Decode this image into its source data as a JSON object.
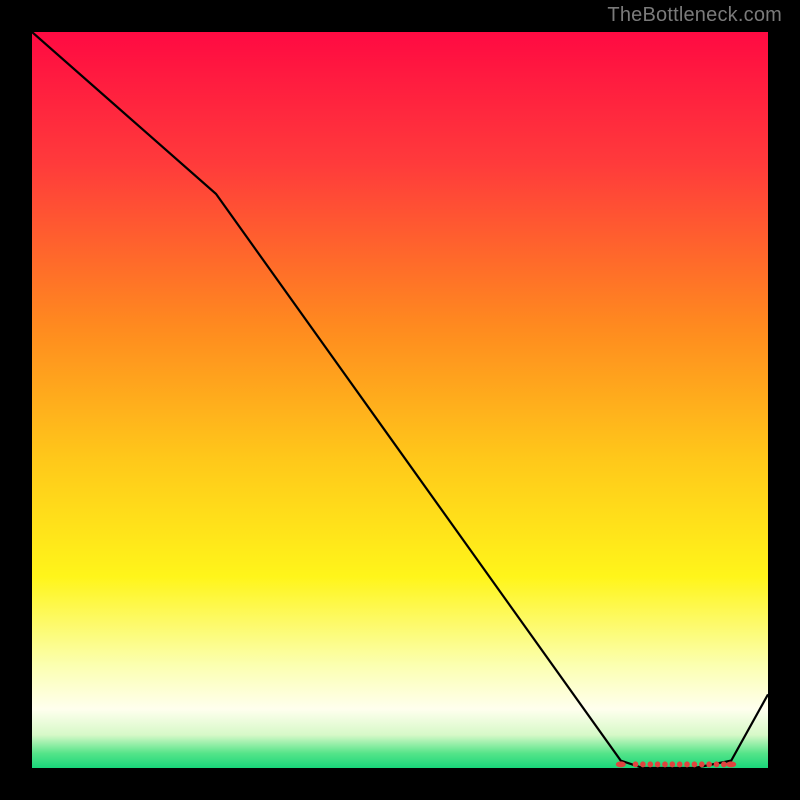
{
  "watermark": "TheBottleneck.com",
  "chart_data": {
    "type": "line",
    "title": "",
    "xlabel": "",
    "ylabel": "",
    "xlim": [
      0,
      100
    ],
    "ylim": [
      0,
      100
    ],
    "grid": false,
    "series": [
      {
        "name": "bottleneck-curve",
        "x": [
          0,
          25,
          80,
          83,
          90,
          95,
          100
        ],
        "values": [
          100,
          78,
          1,
          0,
          0,
          1,
          10
        ]
      }
    ],
    "markers": {
      "x": [
        80,
        82,
        83,
        84,
        85,
        86,
        87,
        88,
        89,
        90,
        91,
        92,
        93,
        94,
        95
      ],
      "y": [
        0.5,
        0.5,
        0.5,
        0.5,
        0.5,
        0.5,
        0.5,
        0.5,
        0.5,
        0.5,
        0.5,
        0.5,
        0.5,
        0.5,
        0.5
      ]
    },
    "gradient_stops": [
      {
        "offset": 0,
        "color": "#ff0a42"
      },
      {
        "offset": 0.18,
        "color": "#ff3b3b"
      },
      {
        "offset": 0.4,
        "color": "#ff8a1f"
      },
      {
        "offset": 0.58,
        "color": "#ffc81a"
      },
      {
        "offset": 0.74,
        "color": "#fff51a"
      },
      {
        "offset": 0.86,
        "color": "#fbffb0"
      },
      {
        "offset": 0.92,
        "color": "#ffffee"
      },
      {
        "offset": 0.955,
        "color": "#d7f9c8"
      },
      {
        "offset": 0.98,
        "color": "#55e489"
      },
      {
        "offset": 1.0,
        "color": "#19d67a"
      }
    ],
    "colors": {
      "line": "#000000",
      "marker": "#e0433f"
    }
  }
}
